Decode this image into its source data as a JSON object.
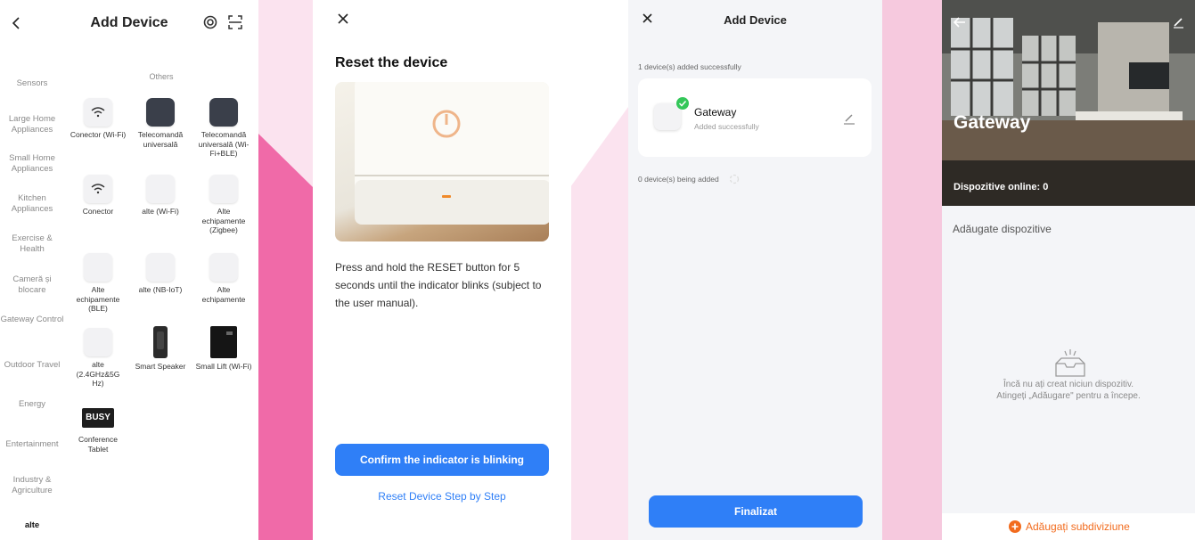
{
  "colors": {
    "accent": "#2f7ff7",
    "orange": "#f26b1d",
    "success": "#34c759",
    "bg_pink": "#fbe3ef"
  },
  "panel1": {
    "title": "Add Device",
    "back_icon": "chevron-left-icon",
    "section_title": "Others",
    "categories": [
      "Sensors",
      "Large Home Appliances",
      "Small Home Appliances",
      "Kitchen Appliances",
      "Exercise & Health",
      "Cameră și blocare",
      "Gateway Control",
      "Outdoor Travel",
      "Energy",
      "Entertainment",
      "Industry & Agriculture",
      "alte"
    ],
    "devices": [
      {
        "label": "Conector (Wi-Fi)",
        "icon": "wifi-icon"
      },
      {
        "label": "Telecomandă universală",
        "icon": "remote-icon"
      },
      {
        "label": "Telecomandă universală (Wi-Fi+BLE)",
        "icon": "remote-icon"
      },
      {
        "label": "Conector",
        "icon": "wifi-icon"
      },
      {
        "label": "alte (Wi-Fi)",
        "icon": "device-icon"
      },
      {
        "label": "Alte echipamente (Zigbee)",
        "icon": "device-icon"
      },
      {
        "label": "Alte echipamente (BLE)",
        "icon": "device-icon"
      },
      {
        "label": "alte (NB-IoT)",
        "icon": "device-icon"
      },
      {
        "label": "Alte echipamente",
        "icon": "device-icon"
      },
      {
        "label": "alte (2.4GHz&5G Hz)",
        "icon": "device-icon"
      },
      {
        "label": "Smart Speaker",
        "icon": "speaker-icon"
      },
      {
        "label": "Small Lift (Wi-Fi)",
        "icon": "lift-icon"
      },
      {
        "label": "Conference Tablet",
        "icon": "tablet-icon",
        "badge": "BUSY"
      }
    ]
  },
  "panel2": {
    "heading": "Reset the device",
    "description": "Press and hold the RESET button for 5 seconds until the indicator blinks (subject to the user manual).",
    "confirm_button": "Confirm the indicator is blinking",
    "link": "Reset Device Step by Step"
  },
  "panel3": {
    "title": "Add Device",
    "added_status": "1 device(s) added successfully",
    "device_name": "Gateway",
    "device_status": "Added successfully",
    "adding_status": "0 device(s) being added",
    "finish_button": "Finalizat"
  },
  "panel4": {
    "title": "Gateway",
    "online": "Dispozitive online: 0",
    "section": "Adăugate dispozitive",
    "empty_line1": "Încă nu ați creat niciun dispozitiv.",
    "empty_line2": "Atingeți „Adăugare\" pentru a începe.",
    "add_sub": "Adăugați subdiviziune"
  }
}
